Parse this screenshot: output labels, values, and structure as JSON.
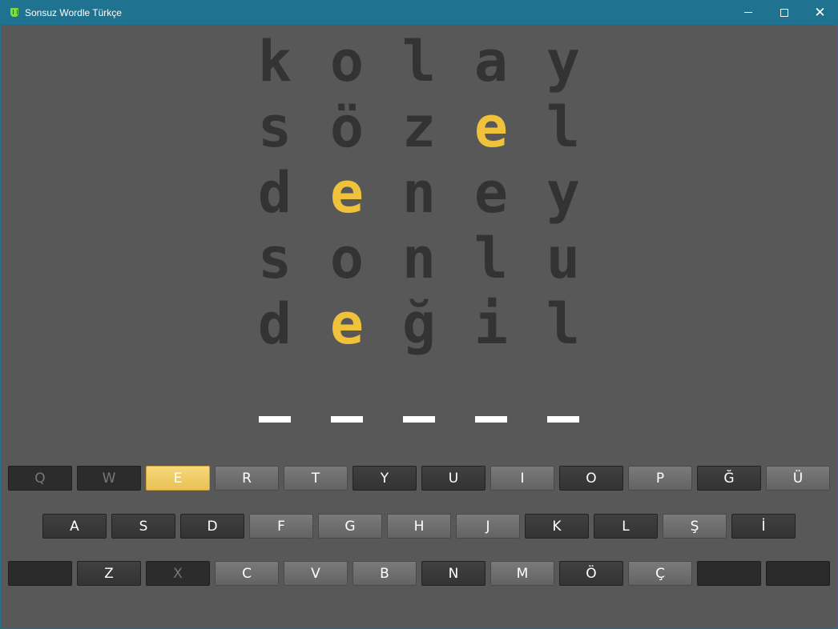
{
  "window": {
    "title": "Sonsuz Wordle Türkçe",
    "minimize_glyph": "",
    "close_glyph": "✕"
  },
  "colors": {
    "present": "#f0c13b",
    "absent_letter": "#333333",
    "background": "#585858",
    "titlebar": "#1f7391"
  },
  "board": {
    "guesses": [
      {
        "letters": [
          "k",
          "o",
          "l",
          "a",
          "y"
        ],
        "states": [
          "absent",
          "absent",
          "absent",
          "absent",
          "absent"
        ]
      },
      {
        "letters": [
          "s",
          "ö",
          "z",
          "e",
          "l"
        ],
        "states": [
          "absent",
          "absent",
          "absent",
          "present",
          "absent"
        ]
      },
      {
        "letters": [
          "d",
          "e",
          "n",
          "e",
          "y"
        ],
        "states": [
          "absent",
          "present",
          "absent",
          "absent",
          "absent"
        ]
      },
      {
        "letters": [
          "s",
          "o",
          "n",
          "l",
          "u"
        ],
        "states": [
          "absent",
          "absent",
          "absent",
          "absent",
          "absent"
        ]
      },
      {
        "letters": [
          "d",
          "e",
          "ğ",
          "i",
          "l"
        ],
        "states": [
          "absent",
          "present",
          "absent",
          "absent",
          "absent"
        ]
      }
    ],
    "current_input_slots": 5
  },
  "keyboard": {
    "rows": [
      [
        {
          "label": "Q",
          "state": "dead"
        },
        {
          "label": "W",
          "state": "dead"
        },
        {
          "label": "E",
          "state": "present"
        },
        {
          "label": "R",
          "state": "unused"
        },
        {
          "label": "T",
          "state": "unused"
        },
        {
          "label": "Y",
          "state": "absent"
        },
        {
          "label": "U",
          "state": "absent"
        },
        {
          "label": "I",
          "state": "unused"
        },
        {
          "label": "O",
          "state": "absent"
        },
        {
          "label": "P",
          "state": "unused"
        },
        {
          "label": "Ğ",
          "state": "absent"
        },
        {
          "label": "Ü",
          "state": "unused"
        }
      ],
      [
        {
          "label": "A",
          "state": "absent"
        },
        {
          "label": "S",
          "state": "absent"
        },
        {
          "label": "D",
          "state": "absent"
        },
        {
          "label": "F",
          "state": "unused"
        },
        {
          "label": "G",
          "state": "unused"
        },
        {
          "label": "H",
          "state": "unused"
        },
        {
          "label": "J",
          "state": "unused"
        },
        {
          "label": "K",
          "state": "absent"
        },
        {
          "label": "L",
          "state": "absent"
        },
        {
          "label": "Ş",
          "state": "unused"
        },
        {
          "label": "İ",
          "state": "absent"
        }
      ],
      [
        {
          "label": "",
          "state": "empty"
        },
        {
          "label": "Z",
          "state": "absent"
        },
        {
          "label": "X",
          "state": "dead"
        },
        {
          "label": "C",
          "state": "unused"
        },
        {
          "label": "V",
          "state": "unused"
        },
        {
          "label": "B",
          "state": "unused"
        },
        {
          "label": "N",
          "state": "absent"
        },
        {
          "label": "M",
          "state": "unused"
        },
        {
          "label": "Ö",
          "state": "absent"
        },
        {
          "label": "Ç",
          "state": "unused"
        },
        {
          "label": "",
          "state": "empty"
        },
        {
          "label": "",
          "state": "empty"
        }
      ]
    ]
  }
}
